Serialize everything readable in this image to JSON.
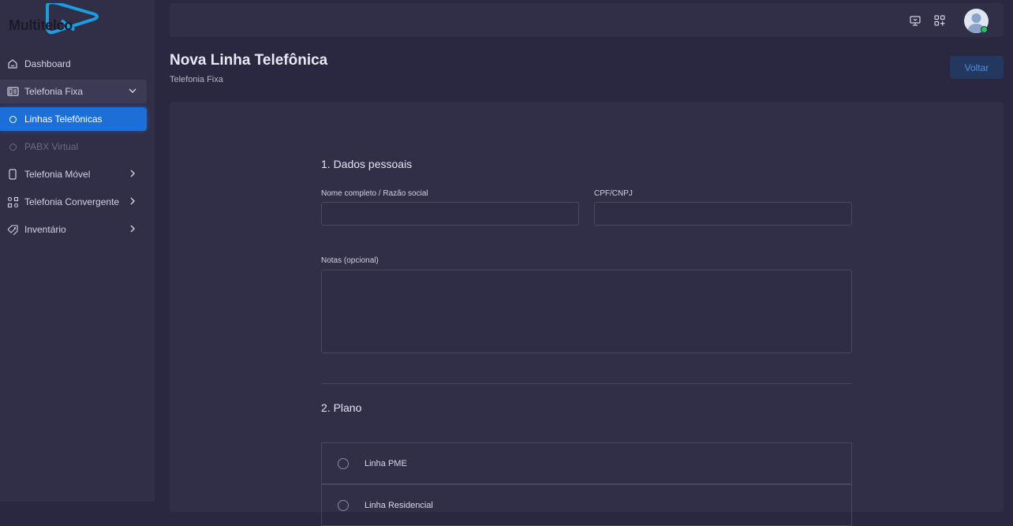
{
  "app": {
    "logo_text": "Multitelco"
  },
  "sidebar": {
    "items": [
      {
        "label": "Dashboard",
        "icon": "home-icon"
      },
      {
        "label": "Telefonia Fixa",
        "icon": "phone-desk-icon",
        "expanded": true
      },
      {
        "label": "Linhas Telefônicas",
        "icon": "circle-dot-icon",
        "active": true
      },
      {
        "label": "PABX Virtual",
        "icon": "circle-dot-icon"
      },
      {
        "label": "Telefonia Móvel",
        "icon": "mobile-icon"
      },
      {
        "label": "Telefonia Convergente",
        "icon": "convergent-icon"
      },
      {
        "label": "Inventário",
        "icon": "tag-icon"
      }
    ]
  },
  "topbar": {
    "icons": [
      "presentation-icon",
      "apps-add-icon"
    ],
    "user_status": "online"
  },
  "header": {
    "title": "Nova Linha Telefônica",
    "subtitle": "Telefonia Fixa",
    "back_label": "Voltar"
  },
  "form": {
    "section1_title": "1. Dados pessoais",
    "name_label": "Nome completo / Razão social",
    "name_value": "",
    "doc_label": "CPF/CNPJ",
    "doc_value": "",
    "notes_label": "Notas (opcional)",
    "notes_value": "",
    "section2_title": "2. Plano",
    "plans": [
      "Linha PME",
      "Linha Residencial"
    ]
  },
  "colors": {
    "accent": "#1d6fd8",
    "sidebar_bg": "#312e48",
    "page_bg": "#2a2840",
    "online": "#22c55e"
  }
}
